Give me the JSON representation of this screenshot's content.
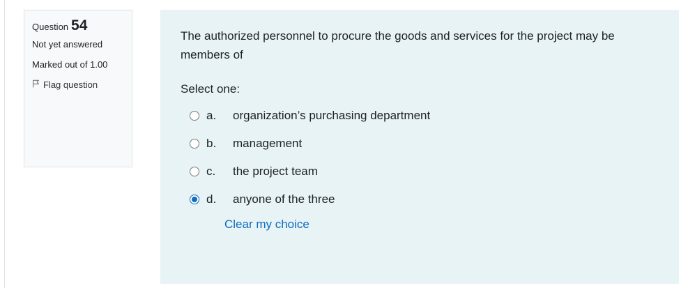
{
  "info": {
    "question_label": "Question",
    "question_number": "54",
    "state": "Not yet answered",
    "grade": "Marked out of 1.00",
    "flag_label": "Flag question"
  },
  "question": {
    "text": "The authorized personnel to procure the goods and services for the project may be members of",
    "prompt": "Select one:",
    "options": [
      {
        "letter": "a.",
        "text": "organization’s purchasing department",
        "selected": false
      },
      {
        "letter": "b.",
        "text": "management",
        "selected": false
      },
      {
        "letter": "c.",
        "text": "the project team",
        "selected": false
      },
      {
        "letter": "d.",
        "text": "anyone of the three",
        "selected": true
      }
    ],
    "clear_label": "Clear my choice"
  },
  "colors": {
    "accent": "#0f6cbf",
    "content_bg": "#e7f3f5",
    "info_bg": "#f8f9fa"
  },
  "icons": {
    "flag": "flag-icon",
    "radio": "radio-button"
  }
}
